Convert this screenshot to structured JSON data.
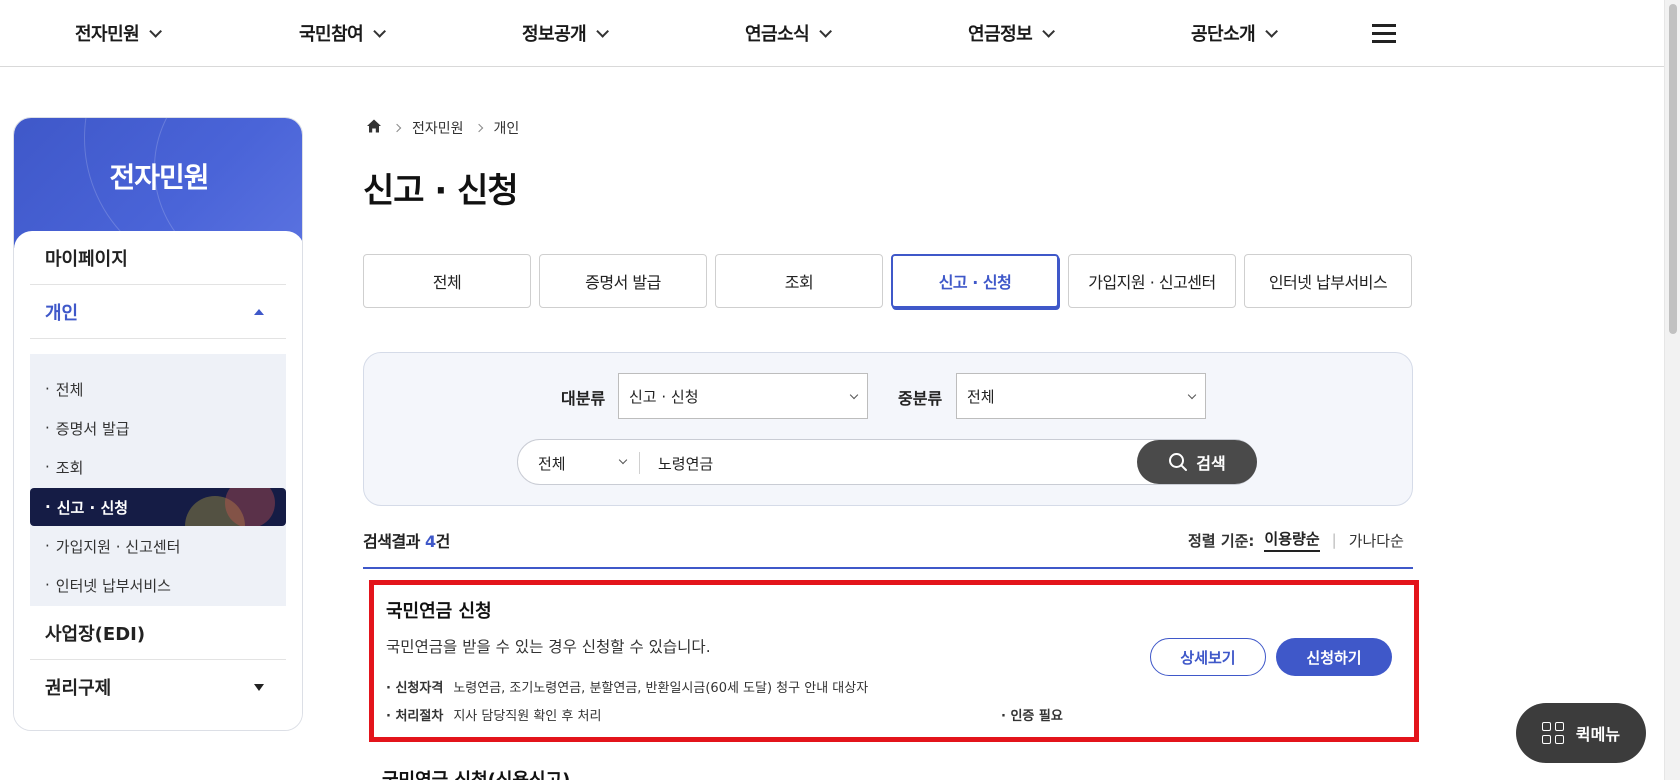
{
  "topnav": {
    "items": [
      {
        "label": "전자민원"
      },
      {
        "label": "국민참여"
      },
      {
        "label": "정보공개"
      },
      {
        "label": "연금소식"
      },
      {
        "label": "연금정보"
      },
      {
        "label": "공단소개"
      }
    ],
    "menu_icon": "hamburger-icon"
  },
  "sidebar": {
    "title": "전자민원",
    "level1": [
      {
        "label": "마이페이지"
      },
      {
        "label": "개인",
        "expanded": true
      },
      {
        "label": "사업장(EDI)"
      },
      {
        "label": "권리구제",
        "expanded": false
      }
    ],
    "sub_items": [
      {
        "label": "전체"
      },
      {
        "label": "증명서 발급"
      },
      {
        "label": "조회"
      },
      {
        "label": "신고 · 신청",
        "active": true
      },
      {
        "label": "가입지원 · 신고센터"
      },
      {
        "label": "인터넷 납부서비스"
      }
    ],
    "bullet": "·"
  },
  "breadcrumb": {
    "home_icon": "home-icon",
    "items": [
      "전자민원",
      "개인"
    ]
  },
  "page_title": "신고 · 신청",
  "tabs": [
    {
      "label": "전체"
    },
    {
      "label": "증명서 발급"
    },
    {
      "label": "조회"
    },
    {
      "label": "신고 · 신청",
      "active": true
    },
    {
      "label": "가입지원 · 신고센터"
    },
    {
      "label": "인터넷 납부서비스"
    }
  ],
  "search": {
    "major_label": "대분류",
    "major_value": "신고 · 신청",
    "minor_label": "중분류",
    "minor_value": "전체",
    "scope_value": "전체",
    "query": "노령연금",
    "button_label": "검색",
    "button_icon": "search-icon"
  },
  "results": {
    "count_prefix": "검색결과 ",
    "count": "4",
    "count_suffix": "건",
    "sort_label": "정렬 기준:",
    "sort_options": [
      "이용량순",
      "가나다순"
    ],
    "sort_separator": "|"
  },
  "card": {
    "title": "국민연금 신청",
    "description": "국민연금을 받을 수 있는 경우 신청할 수 있습니다.",
    "eligibility_label": "신청자격",
    "eligibility_value": "노령연금, 조기노령연금, 분할연금, 반환일시금(60세 도달) 청구 안내 대상자",
    "process_label": "처리절차",
    "process_value": "지사 담당직원 확인 후 처리",
    "auth_label": "인증 필요",
    "details_button": "상세보기",
    "apply_button": "신청하기",
    "highlight_color": "#e3141b"
  },
  "next_card_title": "국민연금 신청(신용신고)",
  "quick_menu": {
    "label": "퀵메뉴",
    "icon": "grid-icon"
  },
  "colors": {
    "accent": "#3f58c9",
    "dark_nav": "#151c45",
    "highlight": "#e3141b"
  }
}
